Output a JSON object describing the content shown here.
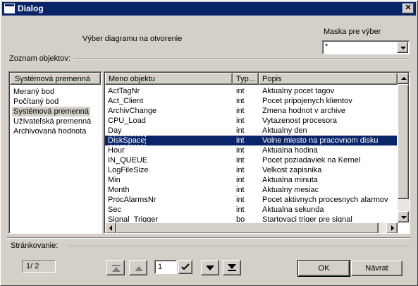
{
  "window": {
    "title": "Dialog",
    "close_glyph": "✕"
  },
  "header": {
    "caption": "Výber diagramu na otvorenie",
    "mask_label": "Maska pre výber",
    "mask_value": "*"
  },
  "objects_label": "Zoznam objektov:",
  "left_list": {
    "header": "Systémová premenná",
    "items": [
      {
        "label": "Meraný bod",
        "selected": false
      },
      {
        "label": "Počítaný bod",
        "selected": false
      },
      {
        "label": "Systémová premenná",
        "selected": true
      },
      {
        "label": "Užívateľská premenná",
        "selected": false
      },
      {
        "label": "Archivovaná hodnota",
        "selected": false
      }
    ]
  },
  "grid": {
    "columns": [
      "Meno objektu",
      "Typ...",
      "Popis"
    ],
    "rows": [
      {
        "name": "ActTagNr",
        "type": "int",
        "desc": "Aktualny pocet tagov",
        "selected": false
      },
      {
        "name": "Act_Client",
        "type": "int",
        "desc": "Pocet pripojenych klientov",
        "selected": false
      },
      {
        "name": "ArchivChange",
        "type": "int",
        "desc": "Zmena hodnot v archive",
        "selected": false
      },
      {
        "name": "CPU_Load",
        "type": "int",
        "desc": "Vytazenost procesora",
        "selected": false
      },
      {
        "name": "Day",
        "type": "int",
        "desc": "Aktualny den",
        "selected": false
      },
      {
        "name": "DiskSpace",
        "type": "int",
        "desc": "Volne miesto na pracovnom disku",
        "selected": true
      },
      {
        "name": "Hour",
        "type": "int",
        "desc": "Aktualna hodina",
        "selected": false
      },
      {
        "name": "IN_QUEUE",
        "type": "int",
        "desc": "Pocet poziadaviek na Kernel",
        "selected": false
      },
      {
        "name": "LogFileSize",
        "type": "int",
        "desc": "Velkost zapisnika",
        "selected": false
      },
      {
        "name": "Min",
        "type": "int",
        "desc": "Aktualna minuta",
        "selected": false
      },
      {
        "name": "Month",
        "type": "int",
        "desc": "Aktualny mesiac",
        "selected": false
      },
      {
        "name": "ProcAlarmsNr",
        "type": "int",
        "desc": "Pocet aktivnych procesnych alarmov",
        "selected": false
      },
      {
        "name": "Sec",
        "type": "int",
        "desc": "Aktualna sekunda",
        "selected": false
      },
      {
        "name": "Signal_Trigger",
        "type": "bo",
        "desc": "Startovaci triger pre signal",
        "selected": false
      }
    ]
  },
  "paging": {
    "label": "Stránkovanie:",
    "page_info": "1/ 2",
    "page_input": "1"
  },
  "buttons": {
    "ok": "OK",
    "back": "Návrat"
  },
  "colors": {
    "selection": "#0a246a",
    "face": "#d4d0c8"
  },
  "icons": [
    "window-icon",
    "close-icon",
    "dropdown-arrow-icon",
    "scroll-up-icon",
    "scroll-down-icon",
    "scroll-left-icon",
    "scroll-right-icon",
    "first-page-icon",
    "prev-page-icon",
    "apply-check-icon",
    "next-page-icon",
    "last-page-icon"
  ]
}
